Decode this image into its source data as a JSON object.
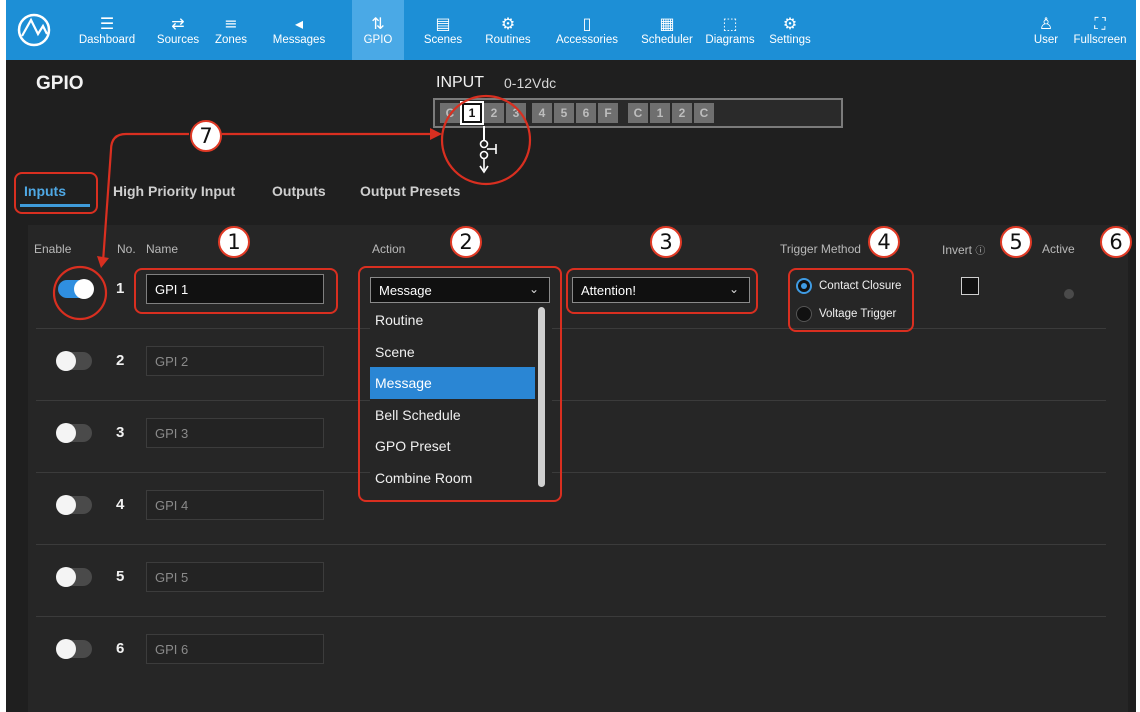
{
  "nav": {
    "items": [
      {
        "label": "Dashboard",
        "icon": "dashboard-icon",
        "glyph": "☰"
      },
      {
        "label": "Sources",
        "icon": "shuffle-icon",
        "glyph": "⇄"
      },
      {
        "label": "Zones",
        "icon": "layers-icon",
        "glyph": "≡"
      },
      {
        "label": "Messages",
        "icon": "megaphone-icon",
        "glyph": "◂"
      },
      {
        "label": "GPIO",
        "icon": "gpio-icon",
        "glyph": "⇅"
      },
      {
        "label": "Scenes",
        "icon": "clapper-icon",
        "glyph": "▤"
      },
      {
        "label": "Routines",
        "icon": "gears-icon",
        "glyph": "⚙"
      },
      {
        "label": "Accessories",
        "icon": "device-icon",
        "glyph": "▯"
      },
      {
        "label": "Scheduler",
        "icon": "calendar-icon",
        "glyph": "▦"
      },
      {
        "label": "Diagrams",
        "icon": "diagram-icon",
        "glyph": "⬚"
      },
      {
        "label": "Settings",
        "icon": "gear-icon",
        "glyph": "⚙"
      }
    ],
    "user": {
      "label": "User",
      "icon": "user-icon",
      "glyph": "♙"
    },
    "fullscreen": {
      "label": "Fullscreen",
      "icon": "fullscreen-icon",
      "glyph": "⛶"
    },
    "accent": "#1d8fd6",
    "active_accent": "#4aa9e6"
  },
  "page": {
    "title": "GPIO"
  },
  "input_header": {
    "title": "INPUT",
    "subtitle": "0-12Vdc"
  },
  "terminal": {
    "pins": [
      "C",
      "1",
      "2",
      "3",
      "4",
      "5",
      "6",
      "F",
      "C",
      "1",
      "2",
      "C"
    ],
    "selected_index": 1
  },
  "tabs": [
    "Inputs",
    "High Priority Input",
    "Outputs",
    "Output Presets"
  ],
  "columns": {
    "enable": "Enable",
    "no": "No.",
    "name": "Name",
    "action": "Action",
    "trigger": "Trigger Method",
    "invert": "Invert",
    "active": "Active"
  },
  "rows": [
    {
      "no": "1",
      "name": "GPI 1",
      "enabled": true
    },
    {
      "no": "2",
      "name": "GPI 2",
      "enabled": false
    },
    {
      "no": "3",
      "name": "GPI 3",
      "enabled": false
    },
    {
      "no": "4",
      "name": "GPI 4",
      "enabled": false
    },
    {
      "no": "5",
      "name": "GPI 5",
      "enabled": false
    },
    {
      "no": "6",
      "name": "GPI 6",
      "enabled": false
    }
  ],
  "action_select": {
    "value": "Message",
    "options": [
      "Routine",
      "Scene",
      "Message",
      "Bell Schedule",
      "GPO Preset",
      "Combine Room"
    ],
    "selected": "Message"
  },
  "target_select": {
    "value": "Attention!"
  },
  "trigger": {
    "options": [
      "Contact Closure",
      "Voltage Trigger"
    ],
    "selected": "Contact Closure"
  },
  "invert_checked": false,
  "callouts": [
    "1",
    "2",
    "3",
    "4",
    "5",
    "6",
    "7"
  ],
  "colors": {
    "highlight": "#d92f20",
    "toggle_on": "#2f8fe0",
    "selected_option": "#2a86d4"
  }
}
